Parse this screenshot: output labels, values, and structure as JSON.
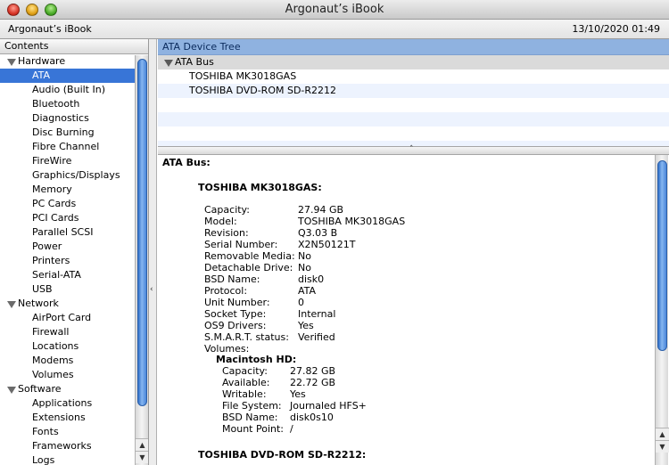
{
  "window": {
    "title": "Argonaut’s iBook"
  },
  "infobar": {
    "computer_name": "Argonaut’s iBook",
    "datetime": "13/10/2020 01:49"
  },
  "sidebar": {
    "header": "Contents",
    "groups": [
      {
        "label": "Hardware",
        "items": [
          "ATA",
          "Audio (Built In)",
          "Bluetooth",
          "Diagnostics",
          "Disc Burning",
          "Fibre Channel",
          "FireWire",
          "Graphics/Displays",
          "Memory",
          "PC Cards",
          "PCI Cards",
          "Parallel SCSI",
          "Power",
          "Printers",
          "Serial-ATA",
          "USB"
        ]
      },
      {
        "label": "Network",
        "items": [
          "AirPort Card",
          "Firewall",
          "Locations",
          "Modems",
          "Volumes"
        ]
      },
      {
        "label": "Software",
        "items": [
          "Applications",
          "Extensions",
          "Fonts",
          "Frameworks",
          "Logs"
        ]
      }
    ],
    "selected": "ATA"
  },
  "device_tree": {
    "header": "ATA Device Tree",
    "bus": "ATA Bus",
    "devices": [
      "TOSHIBA MK3018GAS",
      "TOSHIBA DVD-ROM SD-R2212"
    ]
  },
  "details": {
    "bus_title": "ATA Bus:",
    "dev1_title": "TOSHIBA MK3018GAS:",
    "dev1_fields": [
      [
        "Capacity:",
        "27.94 GB"
      ],
      [
        "Model:",
        "TOSHIBA MK3018GAS"
      ],
      [
        "Revision:",
        "Q3.03 B"
      ],
      [
        "Serial Number:",
        "X2N50121T"
      ],
      [
        "Removable Media:",
        "No"
      ],
      [
        "Detachable Drive:",
        "No"
      ],
      [
        "BSD Name:",
        "disk0"
      ],
      [
        "Protocol:",
        "ATA"
      ],
      [
        "Unit Number:",
        "0"
      ],
      [
        "Socket Type:",
        "Internal"
      ],
      [
        "OS9 Drivers:",
        "Yes"
      ],
      [
        "S.M.A.R.T. status:",
        "Verified"
      ],
      [
        "Volumes:",
        ""
      ]
    ],
    "volume_title": "Macintosh HD:",
    "volume_fields": [
      [
        "Capacity:",
        "27.82 GB"
      ],
      [
        "Available:",
        "22.72 GB"
      ],
      [
        "Writable:",
        "Yes"
      ],
      [
        "File System:",
        "Journaled HFS+"
      ],
      [
        "BSD Name:",
        "disk0s10"
      ],
      [
        "Mount Point:",
        "/"
      ]
    ],
    "dev2_title": "TOSHIBA DVD-ROM SD-R2212:"
  },
  "colors": {
    "selection": "#3875d7",
    "tree_header": "#8fb2e0",
    "scroll_thumb": "#4a86da"
  }
}
